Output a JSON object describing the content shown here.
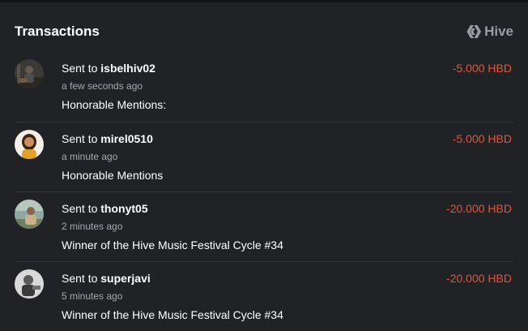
{
  "panel": {
    "title": "Transactions",
    "brand_label": "Hive",
    "brand_icon": "hive-logo-icon"
  },
  "colors": {
    "background": "#202226",
    "amount_negative": "#e2563c",
    "muted_text": "#a5a8ad",
    "divider": "#34363b"
  },
  "transactions": [
    {
      "action": "Sent to",
      "recipient": "isbelhiv02",
      "time": "a few seconds ago",
      "memo": "Honorable Mentions:",
      "amount": "-5.000 HBD"
    },
    {
      "action": "Sent to",
      "recipient": "mirel0510",
      "time": "a minute ago",
      "memo": "Honorable Mentions",
      "amount": "-5.000 HBD"
    },
    {
      "action": "Sent to",
      "recipient": "thonyt05",
      "time": "2 minutes ago",
      "memo": "Winner of the Hive Music Festival Cycle #34",
      "amount": "-20.000 HBD"
    },
    {
      "action": "Sent to",
      "recipient": "superjavi",
      "time": "5 minutes ago",
      "memo": "Winner of the Hive Music Festival Cycle #34",
      "amount": "-20.000 HBD"
    }
  ]
}
